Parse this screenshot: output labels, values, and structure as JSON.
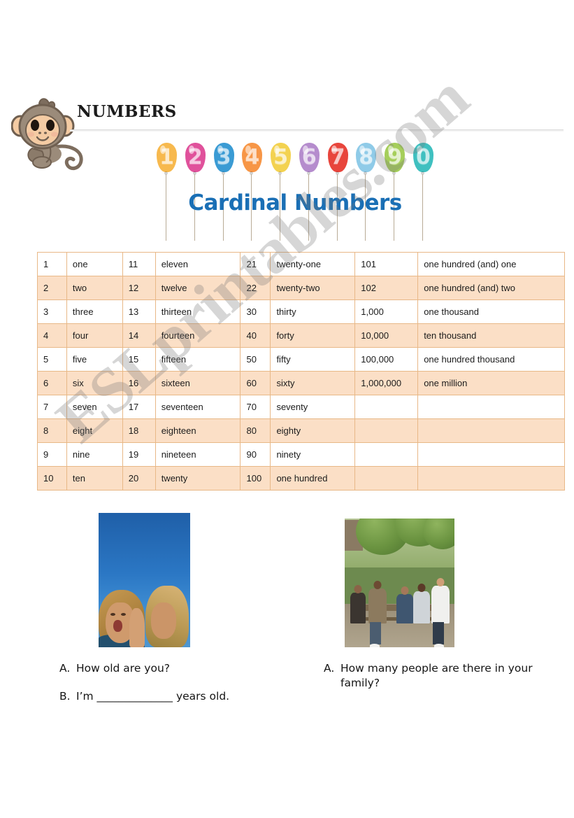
{
  "header": {
    "title": "NUMBERS",
    "mascot_icon": "monkey-mascot-icon"
  },
  "banner": {
    "title": "Cardinal Numbers",
    "title_color": "#1a6fb5",
    "balloons": [
      {
        "digit": "1",
        "color": "#f7b94e"
      },
      {
        "digit": "2",
        "color": "#e0519b"
      },
      {
        "digit": "3",
        "color": "#3a9bd4"
      },
      {
        "digit": "4",
        "color": "#f79646"
      },
      {
        "digit": "5",
        "color": "#f3d250"
      },
      {
        "digit": "6",
        "color": "#b58ccd"
      },
      {
        "digit": "7",
        "color": "#e8453c"
      },
      {
        "digit": "8",
        "color": "#8fcbe8"
      },
      {
        "digit": "9",
        "color": "#a5ce5a"
      },
      {
        "digit": "0",
        "color": "#3fc0c0"
      }
    ]
  },
  "table": {
    "border_color": "#e8b887",
    "shade_color": "#fbdfc6",
    "rows": [
      {
        "shaded": false,
        "cells": [
          "1",
          "one",
          "11",
          "eleven",
          "21",
          "twenty-one",
          "101",
          "one hundred (and) one"
        ]
      },
      {
        "shaded": true,
        "cells": [
          "2",
          "two",
          "12",
          "twelve",
          "22",
          "twenty-two",
          "102",
          "one hundred  (and) two"
        ]
      },
      {
        "shaded": false,
        "cells": [
          "3",
          "three",
          "13",
          "thirteen",
          "30",
          "thirty",
          "1,000",
          "one thousand"
        ]
      },
      {
        "shaded": true,
        "cells": [
          "4",
          "four",
          "14",
          "fourteen",
          "40",
          "forty",
          "10,000",
          "ten thousand"
        ]
      },
      {
        "shaded": false,
        "cells": [
          "5",
          "five",
          "15",
          "fifteen",
          "50",
          "fifty",
          "100,000",
          "one hundred thousand"
        ]
      },
      {
        "shaded": true,
        "cells": [
          "6",
          "six",
          "16",
          "sixteen",
          "60",
          "sixty",
          "1,000,000",
          "one million"
        ]
      },
      {
        "shaded": false,
        "cells": [
          "7",
          "seven",
          "17",
          "seventeen",
          "70",
          "seventy",
          "",
          ""
        ]
      },
      {
        "shaded": true,
        "cells": [
          "8",
          "eight",
          "18",
          "eighteen",
          "80",
          "eighty",
          "",
          ""
        ]
      },
      {
        "shaded": false,
        "cells": [
          "9",
          "nine",
          "19",
          "nineteen",
          "90",
          "ninety",
          "",
          ""
        ]
      },
      {
        "shaded": true,
        "cells": [
          "10",
          "ten",
          "20",
          "twenty",
          "100",
          "one hundred",
          "",
          ""
        ]
      }
    ]
  },
  "photos": {
    "left": {
      "name": "photo-two-girls-laughing"
    },
    "right": {
      "name": "photo-students-on-bench"
    }
  },
  "questions": {
    "left": [
      {
        "label": "A.",
        "text": "How old are you?"
      },
      {
        "label": "B.",
        "text": "I’m ______________ years old."
      }
    ],
    "right": [
      {
        "label": "A.",
        "text": "How many people are there in your family?"
      }
    ]
  },
  "watermark": {
    "text": "ESLprintables.com"
  }
}
